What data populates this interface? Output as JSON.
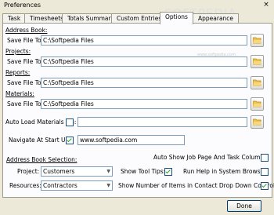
{
  "window": {
    "title": "Preferences",
    "close_glyph": "×"
  },
  "watermark": {
    "main": "SOFTPEDIA",
    "sub": "www.softpedia.com"
  },
  "tabs": [
    {
      "label": "Task"
    },
    {
      "label": "Timesheets"
    },
    {
      "label": "Totals Summary"
    },
    {
      "label": "Custom Entries"
    },
    {
      "label": "Options",
      "active": true
    },
    {
      "label": "Appearance"
    }
  ],
  "sections": {
    "address_book": {
      "heading": "Address Book:",
      "label": "Save File To:",
      "value": "C:\\Softpedia Files"
    },
    "projects": {
      "heading": "Projects:",
      "label": "Save File To:",
      "value": "C:\\Softpedia Files"
    },
    "reports": {
      "heading": "Reports:",
      "label": "Save File To:",
      "value": "C:\\Softpedia Files"
    },
    "materials": {
      "heading": "Materials:",
      "label": "Save File To:",
      "value": "C:\\Softpedia Files"
    }
  },
  "auto_load": {
    "label": "Auto Load Materials DB:",
    "checked": false,
    "value": ""
  },
  "navigate": {
    "label": "Navigate At Start Up:",
    "checked": true,
    "value": "www.softpedia.com"
  },
  "selection": {
    "heading": "Address Book Selection:",
    "project_label": "Project:",
    "project_value": "Customers",
    "resources_label": "Resources:",
    "resources_value": "Contractors"
  },
  "options": {
    "auto_show": "Auto Show Job Page And Task Columns:",
    "tool_tips": "Show Tool Tips:",
    "run_help": "Run Help in System Browser:",
    "show_number": "Show Number of Items in Contact Drop Down Controls:"
  },
  "done_label": "Done",
  "colors": {
    "accent": "#7f9db9",
    "panel": "#fcfcfe",
    "frame": "#ece9d8"
  }
}
